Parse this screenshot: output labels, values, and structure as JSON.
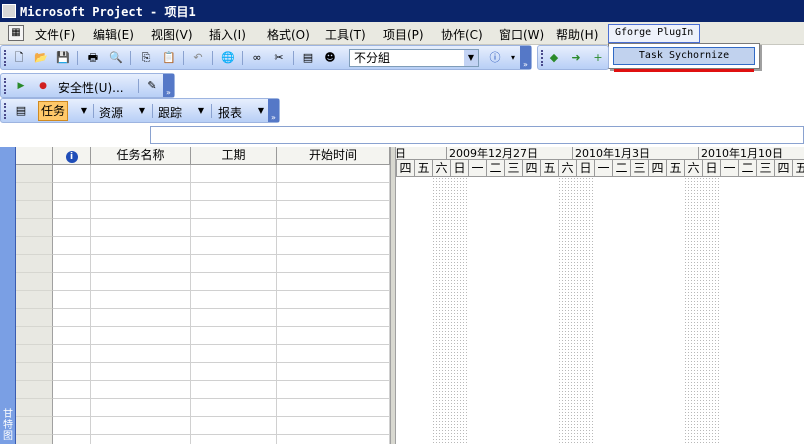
{
  "window": {
    "title": "Microsoft Project - 项目1"
  },
  "menu": {
    "items": [
      {
        "label": "文件(F)"
      },
      {
        "label": "编辑(E)"
      },
      {
        "label": "视图(V)"
      },
      {
        "label": "插入(I)"
      },
      {
        "label": "格式(O)"
      },
      {
        "label": "工具(T)"
      },
      {
        "label": "项目(P)"
      },
      {
        "label": "协作(C)"
      },
      {
        "label": "窗口(W)"
      },
      {
        "label": "帮助(H)"
      },
      {
        "label": "Gforge PlugIn"
      }
    ],
    "open_menu": {
      "items": [
        {
          "label": "Task Sychornize"
        }
      ]
    }
  },
  "toolbar_standard": {
    "group_combo_value": "不分組",
    "icons": [
      "new-icon",
      "open-icon",
      "save-icon",
      "print-icon",
      "print-preview-icon",
      "copy-icon",
      "paste-icon",
      "undo-icon",
      "hyperlink-icon",
      "link-icon",
      "unlink-icon",
      "task-info-icon",
      "assign-resources-icon",
      "help-icon",
      "back-icon",
      "forward-icon",
      "add-icon"
    ]
  },
  "toolbar_security": {
    "label": "安全性(U)..."
  },
  "toolbar_guide": {
    "items": [
      {
        "label": "任务"
      },
      {
        "label": "资源"
      },
      {
        "label": "跟踪"
      },
      {
        "label": "报表"
      }
    ]
  },
  "view_bar": {
    "label": "甘特图"
  },
  "table": {
    "columns": [
      {
        "label": ""
      },
      {
        "label": "任务名称"
      },
      {
        "label": "工期"
      },
      {
        "label": "开始时间"
      }
    ],
    "row_count": 16
  },
  "gantt": {
    "weeks": [
      "日",
      "2009年12月27日",
      "2010年1月3日",
      "2010年1月10日"
    ],
    "days": [
      "四",
      "五",
      "六",
      "日",
      "一",
      "二",
      "三",
      "四",
      "五",
      "六",
      "日",
      "一",
      "二",
      "三",
      "四",
      "五",
      "六",
      "日",
      "一",
      "二",
      "三",
      "四",
      "五"
    ]
  },
  "colors": {
    "titlebar": "#0a246a",
    "toolbar_gradient_top": "#e7effd",
    "toolbar_gradient_bottom": "#b8cff6",
    "menu_highlight": "#c1d2ee",
    "task_button": "#ffc96a",
    "view_bar": "#7a9fe4"
  }
}
